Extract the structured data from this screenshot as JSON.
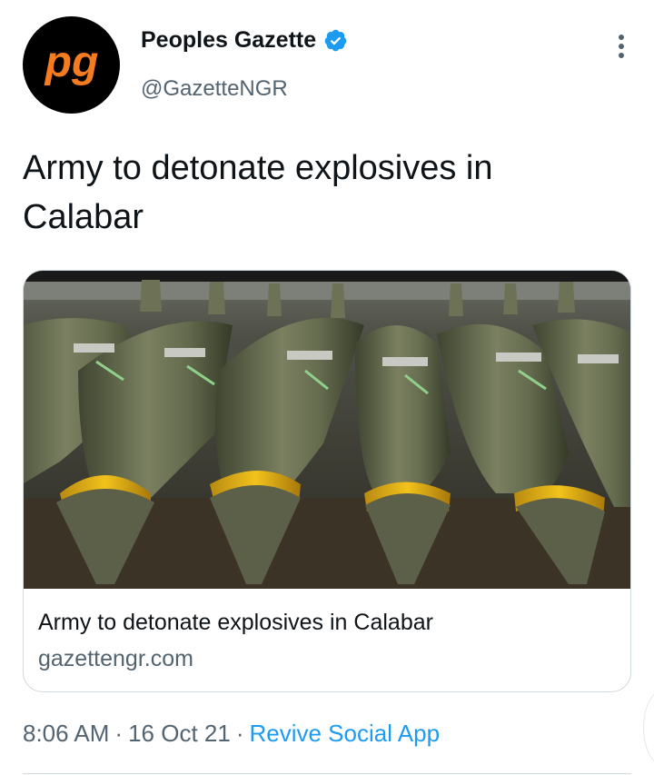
{
  "author": {
    "name": "Peoples Gazette",
    "handle": "@GazetteNGR",
    "avatar_text": "pg",
    "verified": true
  },
  "tweet": {
    "text": "Army to detonate explosives in Calabar"
  },
  "card": {
    "title": "Army to detonate explosives in Calabar",
    "domain": "gazettengr.com",
    "image_icon": "bombs-photo"
  },
  "meta": {
    "time": "8:06 AM",
    "sep1": "·",
    "date": "16 Oct 21",
    "sep2": "·",
    "source": "Revive Social App"
  },
  "colors": {
    "brand_orange": "#f47b20",
    "verified_blue": "#1d9bf0",
    "link_blue": "#1d9bf0",
    "secondary_text": "#536471",
    "primary_text": "#0f1419",
    "border": "#cfd9de"
  },
  "icons": {
    "verified": "verified-badge-icon",
    "more": "more-options-icon"
  }
}
